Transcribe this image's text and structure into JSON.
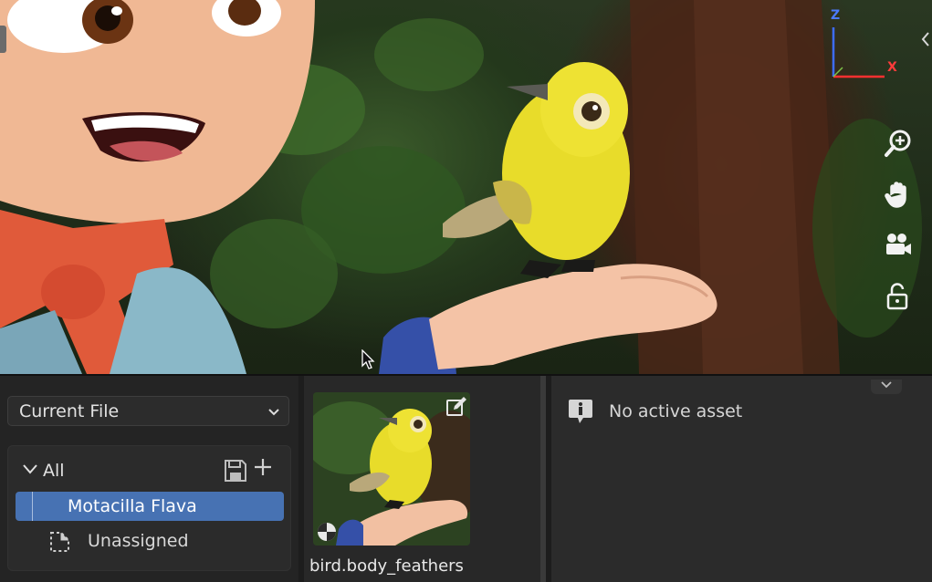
{
  "viewport": {
    "gizmo": {
      "z_label": "Z",
      "x_label": "X"
    },
    "tools": [
      {
        "name": "zoom-icon"
      },
      {
        "name": "pan-hand-icon"
      },
      {
        "name": "camera-icon"
      },
      {
        "name": "lock-icon"
      }
    ],
    "colors": {
      "gizmo_z": "#4b7bff",
      "gizmo_x": "#ff3b3b"
    }
  },
  "asset_browser": {
    "library": {
      "selected": "Current File"
    },
    "catalogs": {
      "root_label": "All",
      "items": [
        {
          "label": "Motacilla Flava",
          "selected": true
        },
        {
          "label": "Unassigned",
          "selected": false
        }
      ]
    },
    "assets": [
      {
        "name": "bird.body_feathers"
      }
    ],
    "side_panel": {
      "message": "No active asset"
    },
    "colors": {
      "selection": "#4772b3",
      "panel_bg": "#2b2b2b"
    }
  }
}
